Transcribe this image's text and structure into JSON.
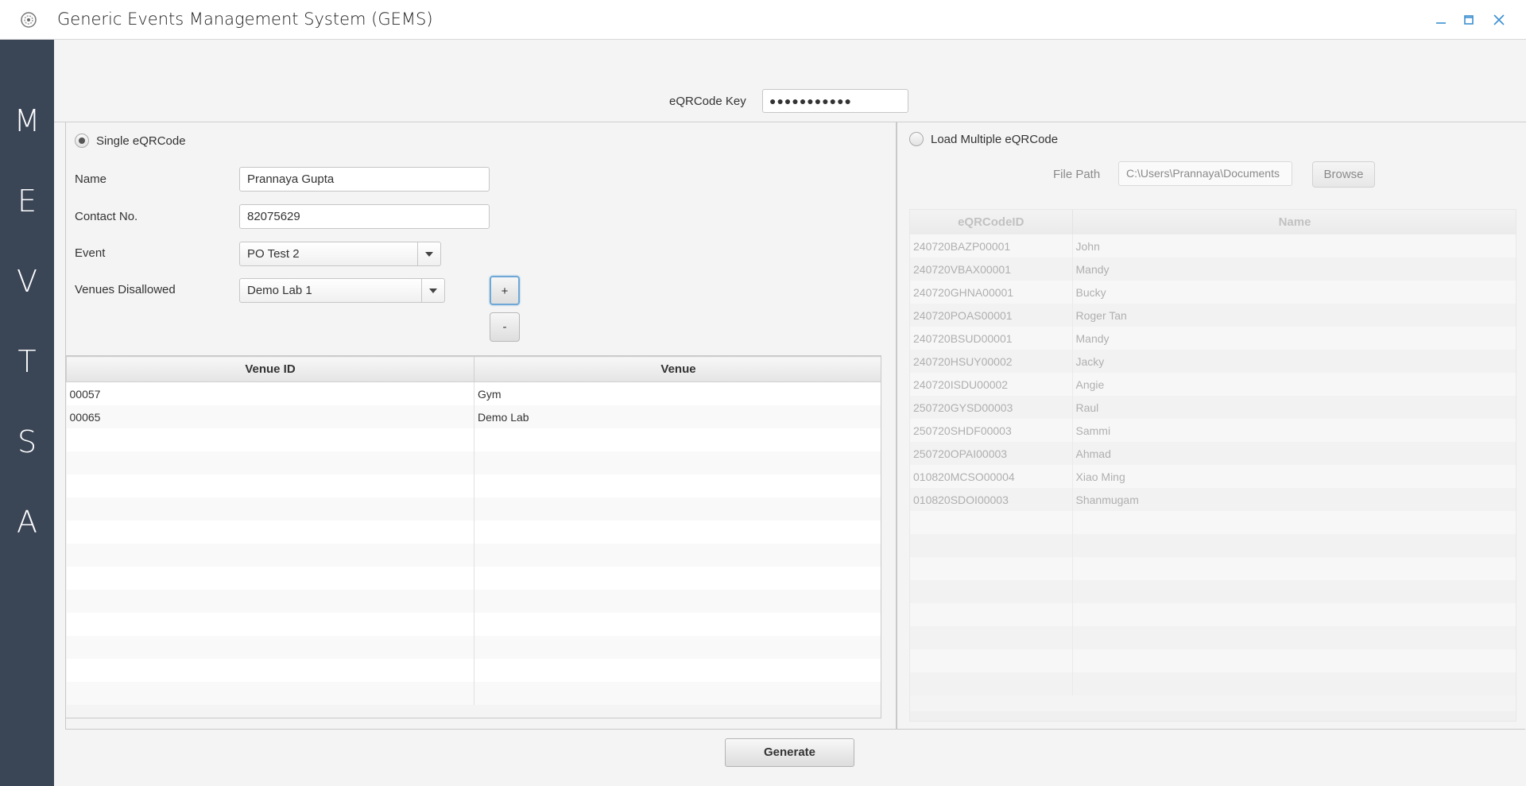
{
  "window": {
    "title": "Generic Events Management System (GEMS)"
  },
  "sidebar": {
    "letters": [
      "M",
      "E",
      "V",
      "T",
      "S",
      "A"
    ]
  },
  "key": {
    "label": "eQRCode Key",
    "value": "●●●●●●●●●●●"
  },
  "single": {
    "radio_label": "Single eQRCode",
    "name_label": "Name",
    "name_value": "Prannaya Gupta",
    "contact_label": "Contact No.",
    "contact_value": "82075629",
    "event_label": "Event",
    "event_value": "PO Test 2",
    "venues_label": "Venues Disallowed",
    "venues_value": "Demo Lab 1",
    "add_label": "+",
    "remove_label": "-",
    "table": {
      "headers": [
        "Venue ID",
        "Venue"
      ],
      "rows": [
        [
          "00057",
          "Gym"
        ],
        [
          "00065",
          "Demo Lab"
        ]
      ]
    }
  },
  "multiple": {
    "radio_label": "Load Multiple eQRCode",
    "filepath_label": "File Path",
    "filepath_value": "C:\\Users\\Prannaya\\Documents",
    "browse_label": "Browse",
    "table": {
      "headers": [
        "eQRCodeID",
        "Name"
      ],
      "rows": [
        [
          "240720BAZP00001",
          "John"
        ],
        [
          "240720VBAX00001",
          "Mandy"
        ],
        [
          "240720GHNA00001",
          "Bucky"
        ],
        [
          "240720POAS00001",
          "Roger Tan"
        ],
        [
          "240720BSUD00001",
          "Mandy"
        ],
        [
          "240720HSUY00002",
          "Jacky"
        ],
        [
          "240720ISDU00002",
          "Angie"
        ],
        [
          "250720GYSD00003",
          "Raul"
        ],
        [
          "250720SHDF00003",
          "Sammi"
        ],
        [
          "250720OPAI00003",
          "Ahmad"
        ],
        [
          "010820MCSO00004",
          "Xiao Ming"
        ],
        [
          "010820SDOI00003",
          "Shanmugam"
        ]
      ]
    }
  },
  "generate_label": "Generate"
}
